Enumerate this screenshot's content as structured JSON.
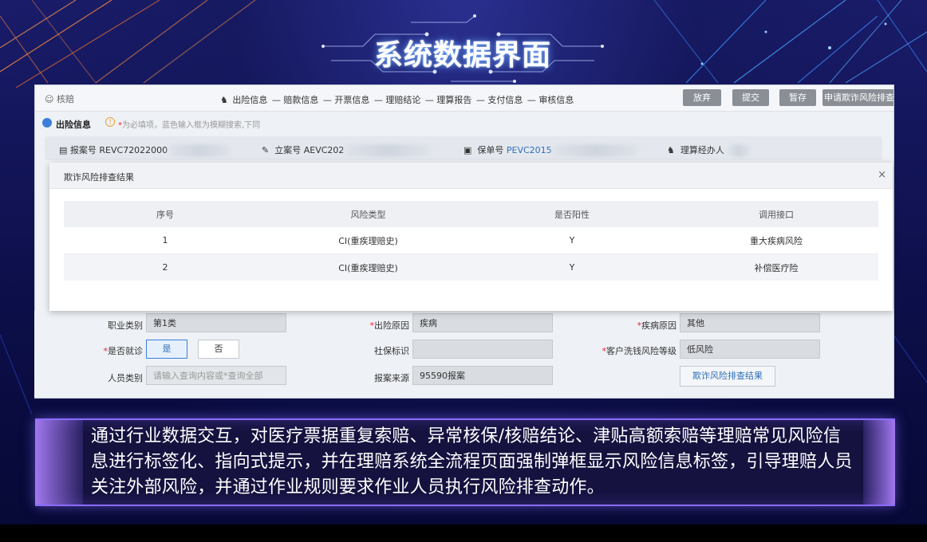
{
  "title": "系统数据界面",
  "topbar": {
    "hezhu": "核赔",
    "steps": [
      "出险信息",
      "赔款信息",
      "开票信息",
      "理赔结论",
      "理算报告",
      "支付信息",
      "审核信息"
    ],
    "buttons": [
      "放弃",
      "提交",
      "暂存",
      "申请欺诈风险排查"
    ]
  },
  "section": {
    "title": "出险信息",
    "hint_star": "*",
    "hint": "为必填项，蓝色输入框为模糊搜索,下同"
  },
  "info": {
    "report_label": "报案号",
    "report_value": "REVC72022000",
    "case_label": "立案号",
    "case_value": "AEVC202",
    "policy_label": "保单号",
    "policy_value": "PEVC2015",
    "adjuster_label": "理算经办人"
  },
  "dialog": {
    "title": "欺诈风险排查结果",
    "close": "×",
    "headers": [
      "序号",
      "风险类型",
      "是否阳性",
      "调用接口"
    ],
    "rows": [
      [
        "1",
        "CI(重疾理赔史)",
        "Y",
        "重大疾病风险"
      ],
      [
        "2",
        "CI(重疾理赔史)",
        "Y",
        "补偿医疗险"
      ]
    ]
  },
  "form": {
    "occupation_label": "职业类别",
    "occupation_value": "第1类",
    "cause_label": "出险原因",
    "cause_value": "疾病",
    "disease_label": "疾病原因",
    "disease_value": "其他",
    "treated_label": "是否就诊",
    "treated_yes": "是",
    "treated_no": "否",
    "social_label": "社保标识",
    "social_value": "",
    "aml_label": "客户洗钱风险等级",
    "aml_value": "低风险",
    "person_label": "人员类别",
    "person_placeholder": "请输入查询内容或*查询全部",
    "source_label": "报案来源",
    "source_value": "95590报案",
    "risk_button": "欺诈风险排查结果"
  },
  "caption": "通过行业数据交互，对医疗票据重复索赔、异常核保/核赔结论、津贴高额索赔等理赔常见风险信息进行标签化、指向式提示，并在理赔系统全流程页面强制弹框显示风险信息标签，引导理赔人员关注外部风险，并通过作业规则要求作业人员执行风险排查动作。"
}
